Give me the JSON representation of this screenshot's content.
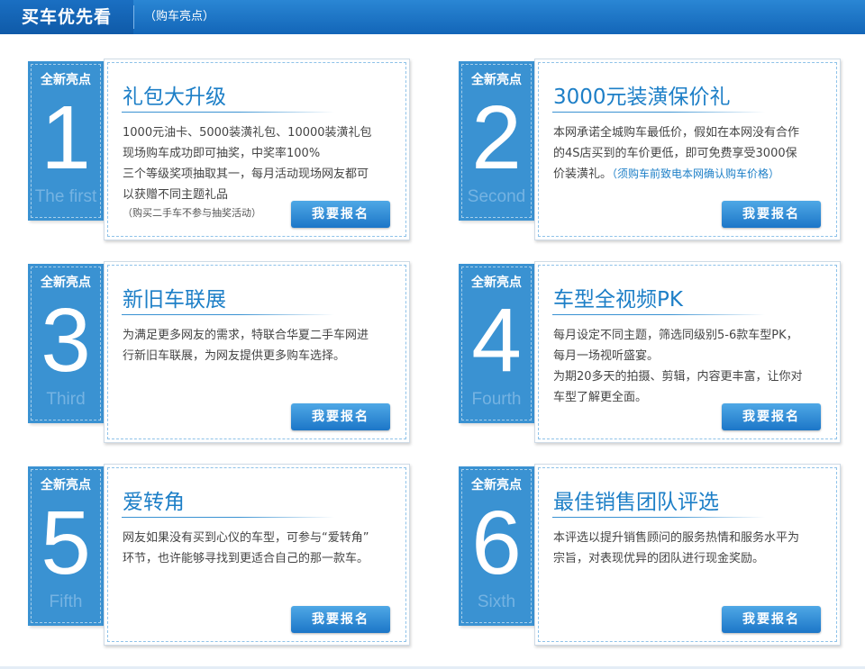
{
  "header": {
    "title": "买车优先看",
    "subtitle": "（购车亮点）"
  },
  "badge_label": "全新亮点",
  "cards": [
    {
      "number": "1",
      "word": "The first",
      "title": "礼包大升级",
      "lines": [
        "1000元油卡、5000装潢礼包、10000装潢礼包",
        "现场购车成功即可抽奖，中奖率100%",
        "三个等级奖项抽取其一，每月活动现场网友都可",
        "以获赠不同主题礼品"
      ],
      "small_note": "（购买二手车不参与抽奖活动）",
      "button": "我要报名"
    },
    {
      "number": "2",
      "word": "Second",
      "title": "3000元装潢保价礼",
      "lines": [
        "本网承诺全城购车最低价，假如在本网没有合作",
        "的4S店买到的车价更低，即可免费享受3000保"
      ],
      "last_line": "价装潢礼。",
      "blue_note": "（须购车前致电本网确认购车价格）",
      "button": "我要报名"
    },
    {
      "number": "3",
      "word": "Third",
      "title": "新旧车联展",
      "lines": [
        "为满足更多网友的需求，特联合华夏二手车网进",
        "行新旧车联展，为网友提供更多购车选择。"
      ],
      "button": "我要报名"
    },
    {
      "number": "4",
      "word": "Fourth",
      "title": "车型全视频PK",
      "lines": [
        "每月设定不同主题，筛选同级别5-6款车型PK，",
        "每月一场视听盛宴。",
        "为期20多天的拍摄、剪辑，内容更丰富，让你对",
        "车型了解更全面。"
      ],
      "button": "我要报名"
    },
    {
      "number": "5",
      "word": "Fifth",
      "title": "爱转角",
      "lines": [
        "网友如果没有买到心仪的车型，可参与“爱转角”",
        "环节，也许能够寻找到更适合自己的那一款车。"
      ],
      "button": "我要报名"
    },
    {
      "number": "6",
      "word": "Sixth",
      "title": "最佳销售团队评选",
      "lines": [
        "本评选以提升销售顾问的服务热情和服务水平为",
        "宗旨，对表现优异的团队进行现金奖励。"
      ],
      "button": "我要报名"
    }
  ],
  "colors": {
    "header": "#1a72c4",
    "accent": "#3a92d2",
    "title": "#1d7fc7",
    "button": "#2a86d4"
  }
}
